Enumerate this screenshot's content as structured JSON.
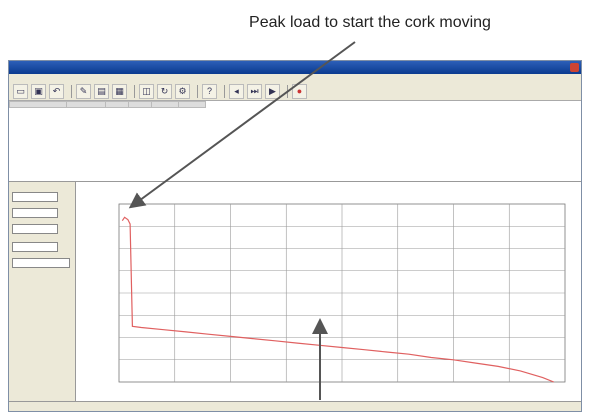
{
  "callouts": {
    "top": "Peak load to start the cork moving"
  },
  "chart_data": {
    "type": "line",
    "x": [
      3,
      5,
      8,
      10,
      12,
      20,
      40,
      60,
      80,
      100,
      120,
      140,
      160,
      180,
      200,
      220,
      240,
      260,
      280,
      300,
      320,
      340,
      360,
      380,
      390
    ],
    "series": [
      {
        "values": [
          145,
          148,
          146,
          142,
          50,
          49,
          47,
          45,
          43,
          41,
          39,
          37,
          35,
          33,
          31,
          29,
          27,
          25,
          22,
          20,
          17,
          14,
          10,
          4,
          0
        ]
      }
    ],
    "xlim": [
      0,
      400
    ],
    "ylim": [
      0,
      160
    ],
    "grid": true,
    "color": "#e06060"
  }
}
